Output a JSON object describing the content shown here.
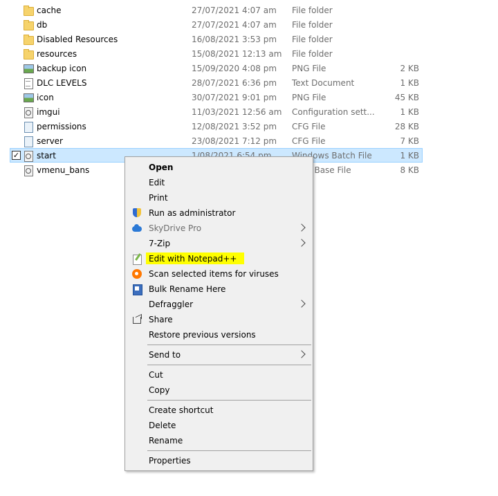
{
  "files": [
    {
      "name": "cache",
      "date": "27/07/2021 4:07 am",
      "type": "File folder",
      "size": "",
      "icon": "folder-icon"
    },
    {
      "name": "db",
      "date": "27/07/2021 4:07 am",
      "type": "File folder",
      "size": "",
      "icon": "folder-icon"
    },
    {
      "name": "Disabled Resources",
      "date": "16/08/2021 3:53 pm",
      "type": "File folder",
      "size": "",
      "icon": "folder-icon"
    },
    {
      "name": "resources",
      "date": "15/08/2021 12:13 am",
      "type": "File folder",
      "size": "",
      "icon": "folder-icon"
    },
    {
      "name": "backup icon",
      "date": "15/09/2020 4:08 pm",
      "type": "PNG File",
      "size": "2 KB",
      "icon": "image-file-icon"
    },
    {
      "name": "DLC LEVELS",
      "date": "28/07/2021 6:36 pm",
      "type": "Text Document",
      "size": "1 KB",
      "icon": "text-file-icon"
    },
    {
      "name": "icon",
      "date": "30/07/2021 9:01 pm",
      "type": "PNG File",
      "size": "45 KB",
      "icon": "image-file-icon"
    },
    {
      "name": "imgui",
      "date": "11/03/2021 12:56 am",
      "type": "Configuration sett...",
      "size": "1 KB",
      "icon": "config-file-icon"
    },
    {
      "name": "permissions",
      "date": "12/08/2021 3:52 pm",
      "type": "CFG File",
      "size": "28 KB",
      "icon": "cfg-file-icon"
    },
    {
      "name": "server",
      "date": "23/08/2021 7:12 pm",
      "type": "CFG File",
      "size": "7 KB",
      "icon": "cfg-file-icon"
    },
    {
      "name": "start",
      "date": "1/08/2021 6:54 pm",
      "type": "Windows Batch File",
      "size": "1 KB",
      "icon": "batch-file-icon",
      "selected": true
    },
    {
      "name": "vmenu_bans",
      "date": "",
      "type": "Data Base File",
      "size": "8 KB",
      "icon": "db-file-icon"
    }
  ],
  "context_menu": {
    "open": "Open",
    "edit": "Edit",
    "print": "Print",
    "run_as_admin": "Run as administrator",
    "skydrive": "SkyDrive Pro",
    "zip": "7-Zip",
    "notepadpp": "Edit with Notepad++",
    "scan": "Scan selected items for viruses",
    "bulk_rename": "Bulk Rename Here",
    "defraggler": "Defraggler",
    "share": "Share",
    "restore": "Restore previous versions",
    "send_to": "Send to",
    "cut": "Cut",
    "copy": "Copy",
    "create_shortcut": "Create shortcut",
    "delete": "Delete",
    "rename": "Rename",
    "properties": "Properties"
  },
  "colors": {
    "selection_bg": "#cce8ff",
    "highlight": "#ffff00",
    "menu_bg": "#f0f0f0"
  }
}
